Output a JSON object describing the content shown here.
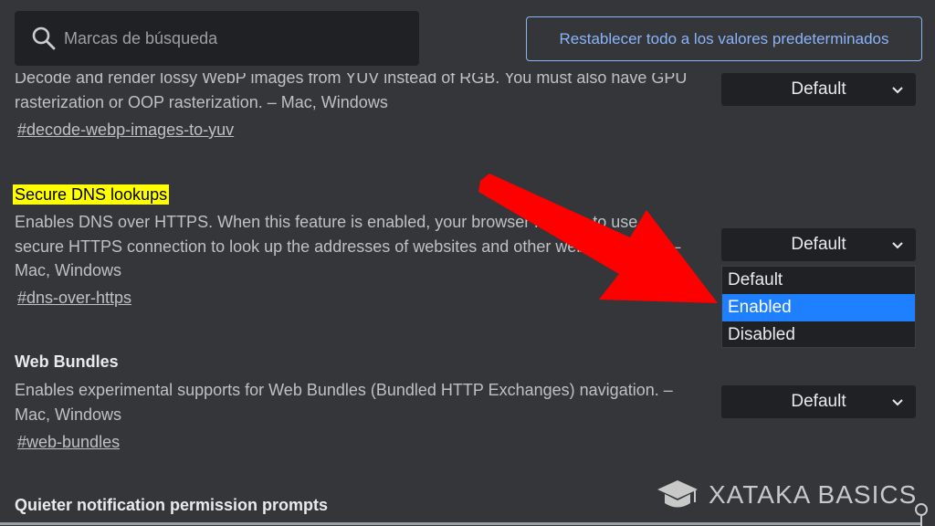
{
  "search": {
    "placeholder": "Marcas de búsqueda"
  },
  "header": {
    "reset_label": "Restablecer todo a los valores predeterminados"
  },
  "flags": [
    {
      "title": "",
      "description_line1": "Decode and render lossy WebP images from YUV instead of RGB. You must also have GPU",
      "description_line2": "rasterization or OOP rasterization. – Mac, Windows",
      "link": "#decode-webp-images-to-yuv",
      "select": "Default"
    },
    {
      "title": "Secure DNS lookups",
      "description_line1": "Enables DNS over HTTPS. When this feature is enabled, your browser may try to use a",
      "description_line2": "secure HTTPS connection to look up the addresses of websites and other web resources. –",
      "description_line3": "Mac, Windows",
      "link": "#dns-over-https",
      "select": "Default",
      "options": [
        "Default",
        "Enabled",
        "Disabled"
      ],
      "highlighted_option": "Enabled"
    },
    {
      "title": "Web Bundles",
      "description_line1": "Enables experimental supports for Web Bundles (Bundled HTTP Exchanges) navigation. –",
      "description_line2": "Mac, Windows",
      "link": "#web-bundles",
      "select": "Default"
    },
    {
      "title": "Quieter notification permission prompts"
    }
  ],
  "watermark": {
    "text": "XATAKA BASICS"
  },
  "colors": {
    "background": "#35363a",
    "accent": "#8ab4f8",
    "highlight": "#ffff00",
    "selected_option": "#1e7fff",
    "arrow": "#ff0000"
  }
}
